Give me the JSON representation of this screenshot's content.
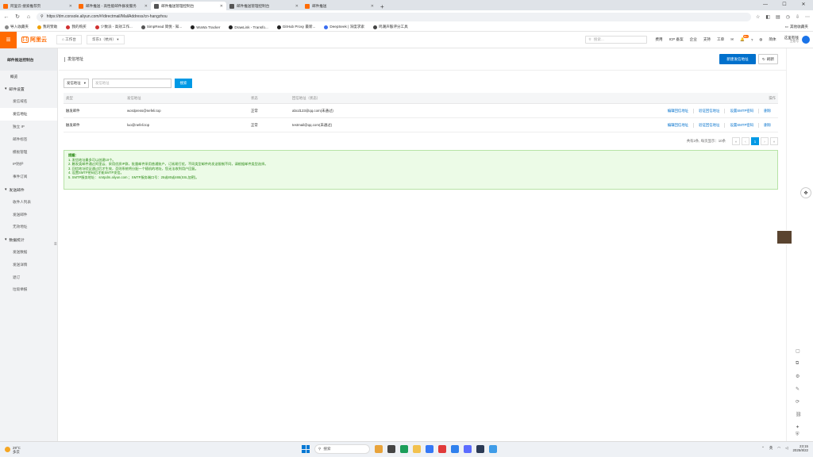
{
  "browser": {
    "tabs": [
      {
        "label": "阿里云-搜索推荐页",
        "color": "#ff6a00",
        "active": false
      },
      {
        "label": "邮件推送 - 高性能邮件群发服务",
        "color": "#ff6a00",
        "active": false
      },
      {
        "label": "邮件推送管理控制台",
        "color": "#555555",
        "active": true
      },
      {
        "label": "邮件推送管理控制台",
        "color": "#555555",
        "active": false
      },
      {
        "label": "邮件推送",
        "color": "#ff6a00",
        "active": false
      }
    ],
    "new_tab": "+",
    "window_controls": [
      "—",
      "☐",
      "✕"
    ],
    "url": "https://dm.console.aliyun.com/#/directmail/MailAddress/cn-hangzhou",
    "bookmarks": [
      {
        "label": "导入收藏夹",
        "color": "#888888"
      },
      {
        "label": "我的赞助",
        "color": "#f0a000"
      },
      {
        "label": "我的购买",
        "color": "#d03030"
      },
      {
        "label": "少数派 - 高效工作...",
        "color": "#d03030"
      },
      {
        "label": "SimpRead 简悦 - 知...",
        "color": "#555555"
      },
      {
        "label": "WuWa Tracker",
        "color": "#222222"
      },
      {
        "label": "DrawLink - Transfo...",
        "color": "#222222"
      },
      {
        "label": "GitHub Proxy 最新...",
        "color": "#222222"
      },
      {
        "label": "DeepSeek | 深度求索",
        "color": "#3a6df0"
      },
      {
        "label": "鸣潮声骸评分工具",
        "color": "#444444"
      }
    ],
    "bookmark_right": "其他收藏夹"
  },
  "header": {
    "brand": "阿里云",
    "brand_mark": "[-]",
    "workspace": "工作台",
    "region": "华东1（杭州）",
    "search_placeholder": "搜索...",
    "items": [
      "费用",
      "ICP 备案",
      "企业",
      "支持",
      "工单"
    ],
    "badge": "99+",
    "lang": "简体",
    "user_name": "这里有钱",
    "user_sub": "主账号"
  },
  "sidebar": {
    "title": "邮件推送控制台",
    "overview": "概览",
    "groups": [
      {
        "label": "邮件设置",
        "items": [
          "发信域名",
          "发信地址",
          "独立 IP",
          "邮件标签",
          "模板管理",
          "IP防护",
          "事件订阅"
        ]
      },
      {
        "label": "发送邮件",
        "items": [
          "收件人列表",
          "发送邮件",
          "无效地址"
        ]
      },
      {
        "label": "数据统计",
        "items": [
          "发送数据",
          "发送详情",
          "退订",
          "垃圾举报"
        ]
      }
    ],
    "active": "发信地址"
  },
  "page": {
    "title": "发信地址",
    "new_button": "新建发信地址",
    "refresh_button": "刷新",
    "filter_select": "发信地址",
    "filter_placeholder": "发信地址",
    "search_button": "搜索"
  },
  "table": {
    "headers": [
      "类型",
      "发信地址",
      "状态",
      "回信地址（状态）",
      "操作"
    ],
    "rows": [
      {
        "type": "触发邮件",
        "address": "wordpress@nefeli.top",
        "status": "正常",
        "reply": "abcd123@qq.com(未通过)"
      },
      {
        "type": "触发邮件",
        "address": "luo@nefeli.top",
        "status": "正常",
        "reply": "testmail@qq.com(未通过)"
      }
    ],
    "ops": [
      "编辑回信地址",
      "验证回信地址",
      "设置SMTP密码",
      "删除"
    ]
  },
  "pager": {
    "info": "共有2条, 每页显示：10条",
    "first": "«",
    "prev": "‹",
    "current": "1",
    "next": "›",
    "last": "»"
  },
  "tips": {
    "heading": "提醒：",
    "lines": [
      "1. 发信地址最多可以创建10个。",
      "2. 触发类邮件通过阿里云、采用优质IP群，批量邮件采用普通账户，订阅易打扰，不同类型邮件的发送限制不同，请根据邮件类型选择。",
      "3. 回信地址验证通过后才生效，否则系统将分配一个随机的地址，您无法收到用户回复。",
      "4. 设置SMTP密码后才能SMTP发信。",
      "5. SMTP服务地址： smtpdm.aliyun.com ；SMTP服务端口号：25或80或465(SSL加密)。"
    ]
  },
  "taskbar": {
    "weather_temp": "29°C",
    "weather_desc": "多云",
    "search_label": "搜索",
    "lang": "英",
    "time": "23:15",
    "date": "2025/8/22"
  },
  "colors": {
    "accent": "#ff6a00",
    "primary": "#0070cc",
    "tip_green": "#2a8a14"
  }
}
